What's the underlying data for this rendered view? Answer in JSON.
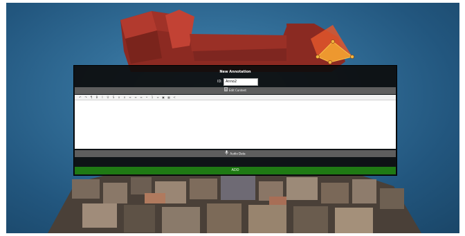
{
  "dialog": {
    "title": "New Annotation",
    "id_label": "ID:",
    "id_value": "Anno2",
    "edit_content_label": "Edit Content",
    "audio_label": "Audio Data",
    "add_label": "ADD",
    "editor_text": ""
  },
  "toolbar": {
    "buttons": [
      {
        "icon": "undo-icon",
        "glyph": "↶"
      },
      {
        "icon": "redo-icon",
        "glyph": "↷"
      },
      {
        "icon": "paragraph-icon",
        "glyph": "¶"
      },
      {
        "icon": "bold-icon",
        "glyph": "B"
      },
      {
        "icon": "italic-icon",
        "glyph": "I"
      },
      {
        "icon": "underline-icon",
        "glyph": "U"
      },
      {
        "icon": "strike-icon",
        "glyph": "S"
      },
      {
        "icon": "subscript-icon",
        "glyph": "x"
      },
      {
        "icon": "superscript-icon",
        "glyph": "x"
      },
      {
        "icon": "align-left-icon",
        "glyph": "≡"
      },
      {
        "icon": "align-center-icon",
        "glyph": "≡"
      },
      {
        "icon": "align-right-icon",
        "glyph": "≡"
      },
      {
        "icon": "list-bullet-icon",
        "glyph": "•"
      },
      {
        "icon": "list-number-icon",
        "glyph": "1"
      },
      {
        "icon": "link-icon",
        "glyph": "∞"
      },
      {
        "icon": "image-icon",
        "glyph": "▣"
      },
      {
        "icon": "table-icon",
        "glyph": "▦"
      },
      {
        "icon": "code-icon",
        "glyph": "<"
      }
    ]
  },
  "colors": {
    "sky": "#336f99",
    "dialog_bg": "#0c0c0c",
    "bar_bg": "#5e5e5e",
    "add_bg": "#1f7a14",
    "highlight_face": "#e8702a",
    "handle": "#f2b640"
  }
}
